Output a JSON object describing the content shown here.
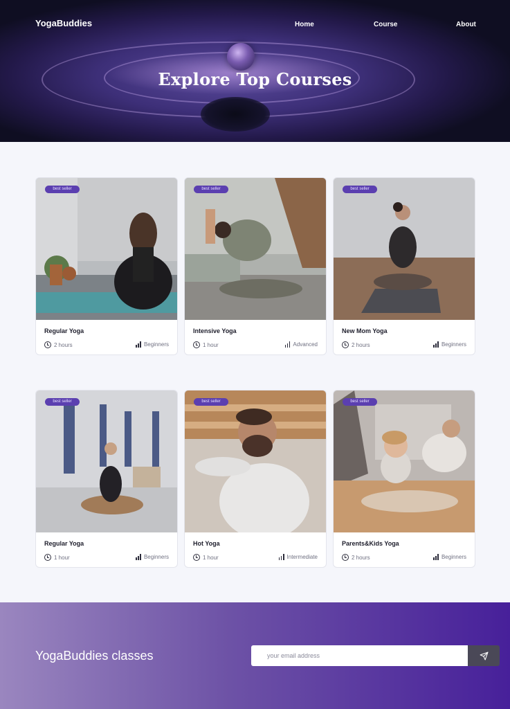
{
  "header": {
    "logo": "YogaBuddies",
    "nav": [
      {
        "label": "Home"
      },
      {
        "label": "Course"
      },
      {
        "label": "About"
      }
    ],
    "title": "Explore Top Courses"
  },
  "courses": [
    {
      "badge": "best seller",
      "title": "Regular Yoga",
      "duration": "2 hours",
      "level": "Beginners"
    },
    {
      "badge": "best seller",
      "title": "Intensive Yoga",
      "duration": "1 hour",
      "level": "Advanced"
    },
    {
      "badge": "best seller",
      "title": "New Mom Yoga",
      "duration": "2 hours",
      "level": "Beginners"
    },
    {
      "badge": "best seller",
      "title": "Regular Yoga",
      "duration": "1 hour",
      "level": "Beginners"
    },
    {
      "badge": "best seller",
      "title": "Hot Yoga",
      "duration": "1 hour",
      "level": "Intermediate"
    },
    {
      "badge": "best seller",
      "title": "Parents&Kids Yoga",
      "duration": "2 hours",
      "level": "Beginners"
    }
  ],
  "footer": {
    "title": "YogaBuddies classes",
    "email_placeholder": "your email address"
  },
  "colors": {
    "accent": "#5b3fb0",
    "footer_start": "#9a86bf",
    "footer_end": "#47209a",
    "send_button": "#4a4857"
  }
}
